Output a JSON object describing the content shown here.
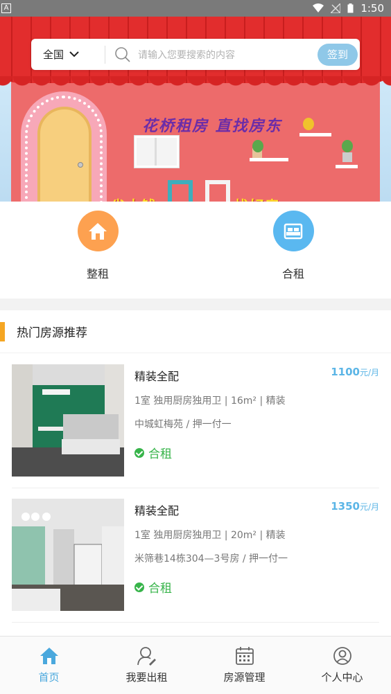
{
  "status_bar": {
    "time": "1:50",
    "left_indicator": "A"
  },
  "banner": {
    "slogan": "花桥租房 直找房东",
    "bottom_left": "省大钱",
    "bottom_right": "找好房"
  },
  "search": {
    "city": "全国",
    "placeholder": "请输入您要搜索的内容",
    "signin_label": "签到"
  },
  "categories": [
    {
      "label": "整租",
      "icon": "house-icon",
      "color": "#fda150"
    },
    {
      "label": "合租",
      "icon": "bed-icon",
      "color": "#5ab8f0"
    }
  ],
  "recommend": {
    "title": "热门房源推荐",
    "listings": [
      {
        "title": "精装全配",
        "price": "1100",
        "unit": "元/月",
        "specs": "1室 独用厨房独用卫 | 16m² | 精装",
        "location": "中城虹梅苑 / 押一付一",
        "tag": "合租"
      },
      {
        "title": "精装全配",
        "price": "1350",
        "unit": "元/月",
        "specs": "1室 独用厨房独用卫 | 20m² | 精装",
        "location": "米筛巷14栋304—3号房 / 押一付一",
        "tag": "合租"
      }
    ]
  },
  "bottom_nav": [
    {
      "label": "首页",
      "icon": "home-icon",
      "active": true
    },
    {
      "label": "我要出租",
      "icon": "user-edit-icon",
      "active": false
    },
    {
      "label": "房源管理",
      "icon": "calendar-icon",
      "active": false
    },
    {
      "label": "个人中心",
      "icon": "profile-icon",
      "active": false
    }
  ],
  "colors": {
    "accent": "#4aa8dd",
    "price": "#5bb5e6",
    "tag": "#37b44a",
    "section_bar": "#f5a623"
  }
}
